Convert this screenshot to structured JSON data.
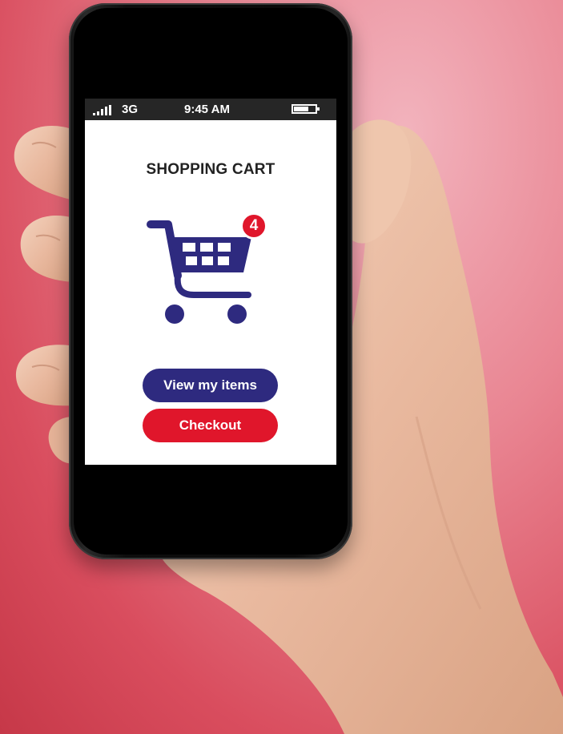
{
  "status_bar": {
    "network": "3G",
    "time": "9:45 AM"
  },
  "screen": {
    "title": "SHOPPING CART",
    "cart_count": "4"
  },
  "buttons": {
    "view_items_label": "View my items",
    "checkout_label": "Checkout"
  },
  "colors": {
    "primary_navy": "#2e2a7f",
    "accent_red": "#e0162b",
    "background_red": "#d94d5e"
  },
  "icons": [
    "signal-icon",
    "battery-icon",
    "shopping-cart-icon"
  ]
}
